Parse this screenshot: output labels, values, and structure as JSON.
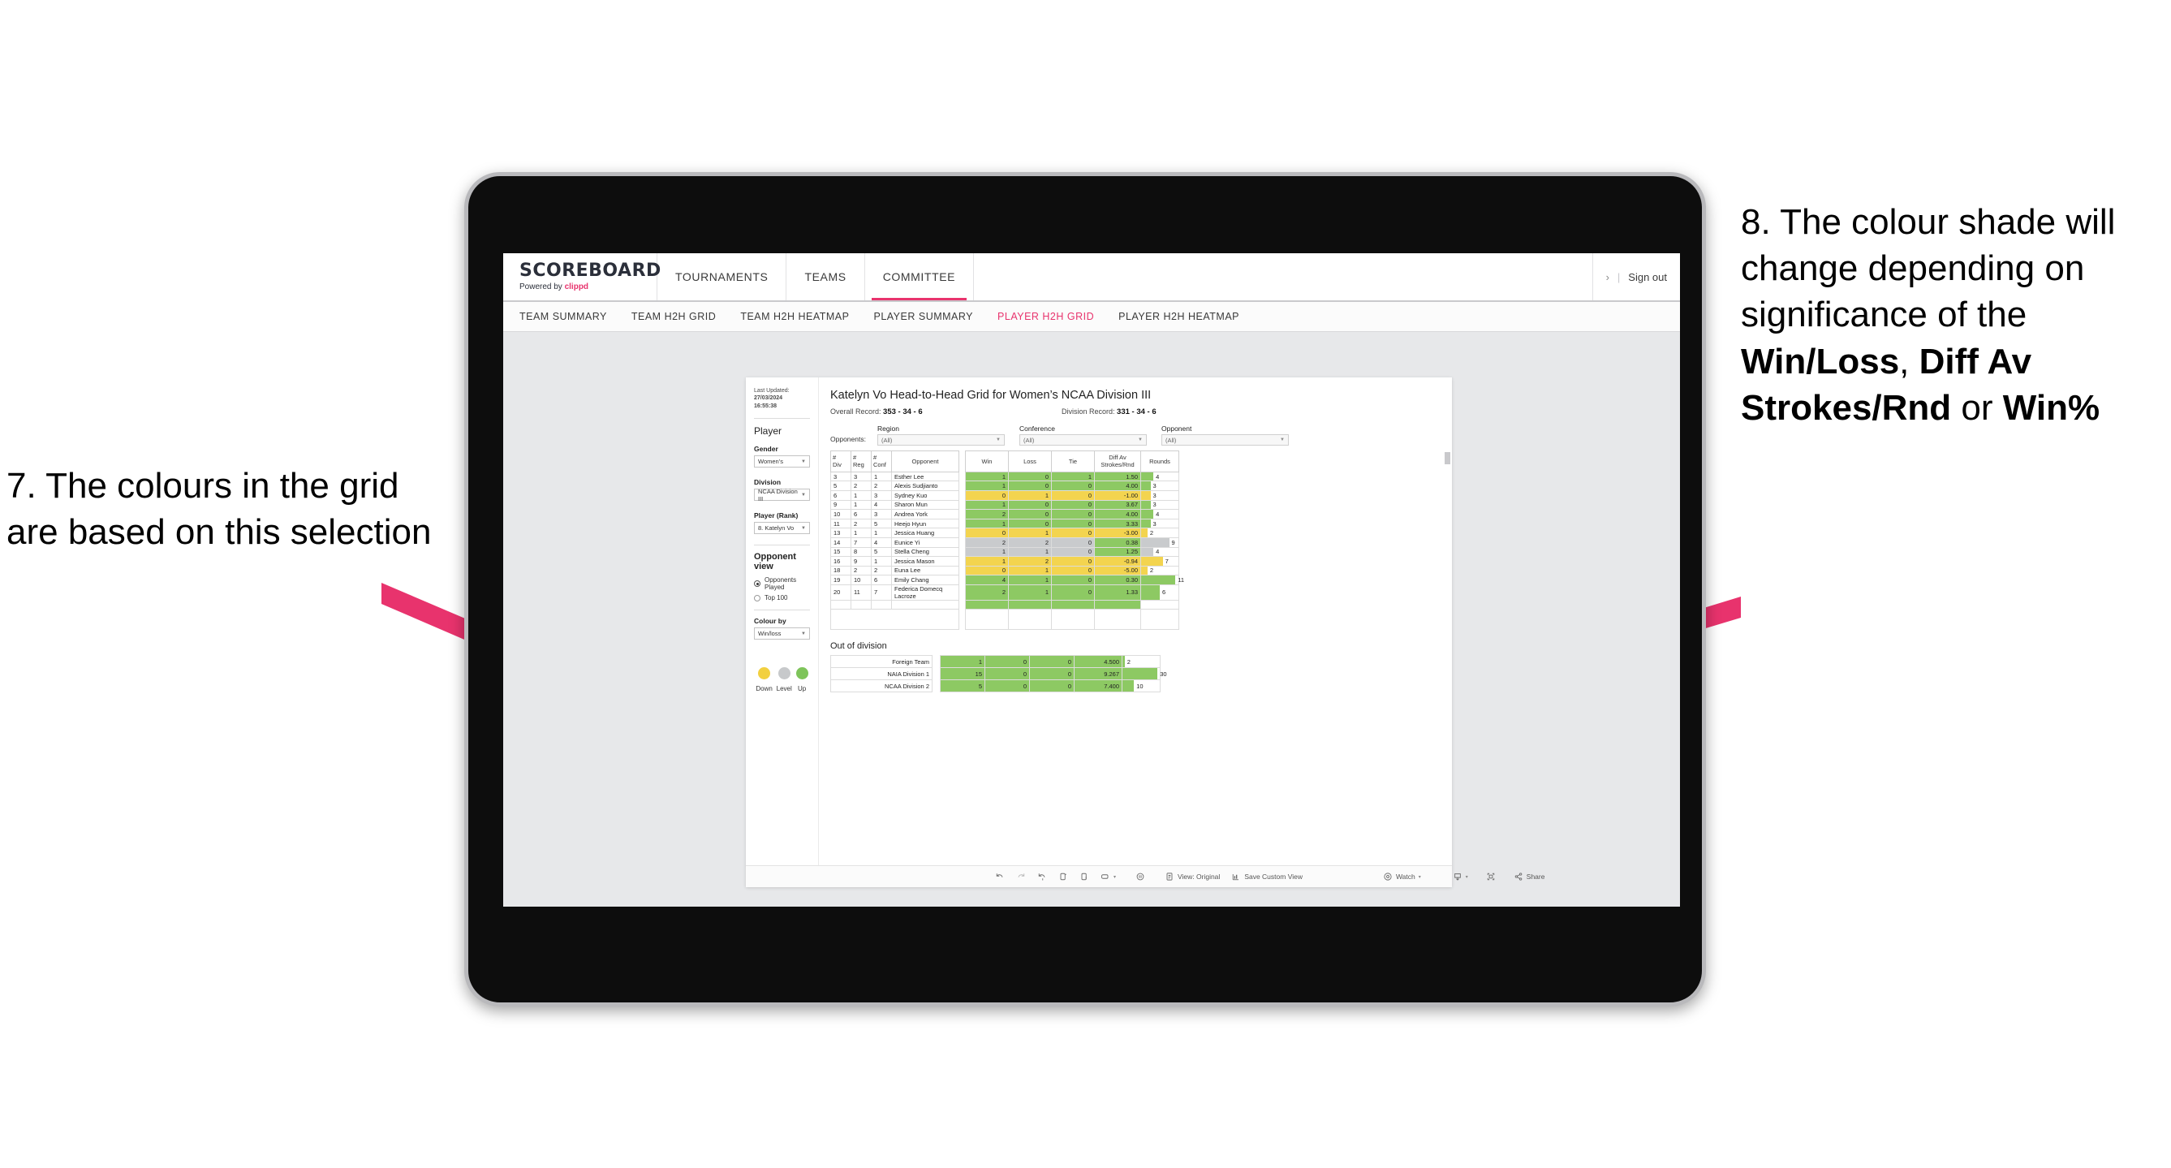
{
  "annotations": {
    "left": "7. The colours in the grid are based on this selection",
    "right_plain_1": "8. The colour shade will change depending on significance of the ",
    "right_bold_1": "Win/Loss",
    "right_mid_1": ", ",
    "right_bold_2": "Diff Av Strokes/Rnd",
    "right_mid_2": " or ",
    "right_bold_3": "Win%"
  },
  "topnav": {
    "brand_name": "SCOREBOARD",
    "brand_powered": "Powered by ",
    "brand_clippd": "clippd",
    "items": [
      {
        "label": "TOURNAMENTS",
        "active": false
      },
      {
        "label": "TEAMS",
        "active": false
      },
      {
        "label": "COMMITTEE",
        "active": true
      }
    ],
    "chevron": "›",
    "divider": "|",
    "signout": "Sign out"
  },
  "subnav": {
    "items": [
      {
        "label": "TEAM SUMMARY",
        "active": false
      },
      {
        "label": "TEAM H2H GRID",
        "active": false
      },
      {
        "label": "TEAM H2H HEATMAP",
        "active": false
      },
      {
        "label": "PLAYER SUMMARY",
        "active": false
      },
      {
        "label": "PLAYER H2H GRID",
        "active": true
      },
      {
        "label": "PLAYER H2H HEATMAP",
        "active": false
      }
    ]
  },
  "sidebar": {
    "last_updated_label": "Last Updated: ",
    "last_updated_date": "27/03/2024",
    "last_updated_time": "16:55:38",
    "player_heading": "Player",
    "gender_label": "Gender",
    "gender_value": "Women’s",
    "division_label": "Division",
    "division_value": "NCAA Division III",
    "player_rank_label": "Player (Rank)",
    "player_rank_value": "8. Katelyn Vo",
    "opponent_view_heading": "Opponent view",
    "opponent_options": [
      {
        "label": "Opponents Played",
        "selected": true
      },
      {
        "label": "Top 100",
        "selected": false
      }
    ],
    "colour_by_label": "Colour by",
    "colour_by_value": "Win/loss",
    "legend": [
      {
        "label": "Down",
        "color": "#f2d03f"
      },
      {
        "label": "Level",
        "color": "#c7c9cb"
      },
      {
        "label": "Up",
        "color": "#7ec45a"
      }
    ]
  },
  "main": {
    "title": "Katelyn Vo Head-to-Head Grid for Women’s NCAA Division III",
    "overall_record_label": "Overall Record: ",
    "overall_record_value": "353 -  34 - 6",
    "division_record_label": "Division Record: ",
    "division_record_value": "331 -  34 - 6",
    "opponents_label": "Opponents:",
    "filters": [
      {
        "label": "Region",
        "value": "(All)"
      },
      {
        "label": "Conference",
        "value": "(All)"
      },
      {
        "label": "Opponent",
        "value": "(All)"
      }
    ],
    "out_of_division_heading": "Out of division"
  },
  "chart_data": {
    "type": "table",
    "title": "Katelyn Vo Head-to-Head Grid for Women’s NCAA Division III",
    "columns": [
      "# Div",
      "# Reg",
      "# Conf",
      "Opponent",
      "Win",
      "Loss",
      "Tie",
      "Diff Av Strokes/Rnd",
      "Rounds"
    ],
    "column_header_lines": [
      [
        "#",
        "Div"
      ],
      [
        "#",
        "Reg"
      ],
      [
        "#",
        "Conf"
      ],
      [
        "Opponent"
      ],
      [
        "Win"
      ],
      [
        "Loss"
      ],
      [
        "Tie"
      ],
      [
        "Diff Av",
        "Strokes/Rnd"
      ],
      [
        "Rounds"
      ]
    ],
    "rounds_max": 12,
    "rows": [
      {
        "div": "3",
        "reg": "3",
        "conf": "1",
        "opponent": "Esther Lee",
        "win": "1",
        "loss": "0",
        "tie": "1",
        "diff": "1.50",
        "rounds": "4",
        "rounds_val": 4,
        "color": "#8dc963"
      },
      {
        "div": "5",
        "reg": "2",
        "conf": "2",
        "opponent": "Alexis Sudjianto",
        "win": "1",
        "loss": "0",
        "tie": "0",
        "diff": "4.00",
        "rounds": "3",
        "rounds_val": 3,
        "color": "#8dc963"
      },
      {
        "div": "6",
        "reg": "1",
        "conf": "3",
        "opponent": "Sydney Kuo",
        "win": "0",
        "loss": "1",
        "tie": "0",
        "diff": "-1.00",
        "rounds": "3",
        "rounds_val": 3,
        "color": "#f3d44f"
      },
      {
        "div": "9",
        "reg": "1",
        "conf": "4",
        "opponent": "Sharon Mun",
        "win": "1",
        "loss": "0",
        "tie": "0",
        "diff": "3.67",
        "rounds": "3",
        "rounds_val": 3,
        "color": "#8dc963"
      },
      {
        "div": "10",
        "reg": "6",
        "conf": "3",
        "opponent": "Andrea York",
        "win": "2",
        "loss": "0",
        "tie": "0",
        "diff": "4.00",
        "rounds": "4",
        "rounds_val": 4,
        "color": "#8dc963"
      },
      {
        "div": "11",
        "reg": "2",
        "conf": "5",
        "opponent": "Heejo Hyun",
        "win": "1",
        "loss": "0",
        "tie": "0",
        "diff": "3.33",
        "rounds": "3",
        "rounds_val": 3,
        "color": "#8dc963"
      },
      {
        "div": "13",
        "reg": "1",
        "conf": "1",
        "opponent": "Jessica Huang",
        "win": "0",
        "loss": "1",
        "tie": "0",
        "diff": "-3.00",
        "rounds": "2",
        "rounds_val": 2,
        "color": "#f3d44f"
      },
      {
        "div": "14",
        "reg": "7",
        "conf": "4",
        "opponent": "Eunice Yi",
        "win": "2",
        "loss": "2",
        "tie": "0",
        "diff": "0.38",
        "rounds": "9",
        "rounds_val": 9,
        "color": "#c9cbcd",
        "diff_color": "#8dc963"
      },
      {
        "div": "15",
        "reg": "8",
        "conf": "5",
        "opponent": "Stella Cheng",
        "win": "1",
        "loss": "1",
        "tie": "0",
        "diff": "1.25",
        "rounds": "4",
        "rounds_val": 4,
        "color": "#c9cbcd",
        "diff_color": "#8dc963"
      },
      {
        "div": "16",
        "reg": "9",
        "conf": "1",
        "opponent": "Jessica Mason",
        "win": "1",
        "loss": "2",
        "tie": "0",
        "diff": "-0.94",
        "rounds": "7",
        "rounds_val": 7,
        "color": "#f3d44f"
      },
      {
        "div": "18",
        "reg": "2",
        "conf": "2",
        "opponent": "Euna Lee",
        "win": "0",
        "loss": "1",
        "tie": "0",
        "diff": "-5.00",
        "rounds": "2",
        "rounds_val": 2,
        "color": "#f3d44f"
      },
      {
        "div": "19",
        "reg": "10",
        "conf": "6",
        "opponent": "Emily Chang",
        "win": "4",
        "loss": "1",
        "tie": "0",
        "diff": "0.30",
        "rounds": "11",
        "rounds_val": 11,
        "color": "#8dc963"
      },
      {
        "div": "20",
        "reg": "11",
        "conf": "7",
        "opponent": "Federica Domecq Lacroze",
        "win": "2",
        "loss": "1",
        "tie": "0",
        "diff": "1.33",
        "rounds": "6",
        "rounds_val": 6,
        "color": "#8dc963"
      }
    ],
    "out_of_division": {
      "rounds_max": 32,
      "rows": [
        {
          "name": "Foreign Team",
          "win": "1",
          "loss": "0",
          "tie": "0",
          "diff": "4.500",
          "rounds": "2",
          "rounds_val": 2,
          "color": "#8dc963"
        },
        {
          "name": "NAIA Division 1",
          "win": "15",
          "loss": "0",
          "tie": "0",
          "diff": "9.267",
          "rounds": "30",
          "rounds_val": 30,
          "color": "#8dc963"
        },
        {
          "name": "NCAA Division 2",
          "win": "5",
          "loss": "0",
          "tie": "0",
          "diff": "7.400",
          "rounds": "10",
          "rounds_val": 10,
          "color": "#8dc963"
        }
      ]
    }
  },
  "toolbar": {
    "view_label": "View: Original",
    "save_label": "Save Custom View",
    "watch_label": "Watch",
    "share_label": "Share",
    "caret": "▾"
  }
}
